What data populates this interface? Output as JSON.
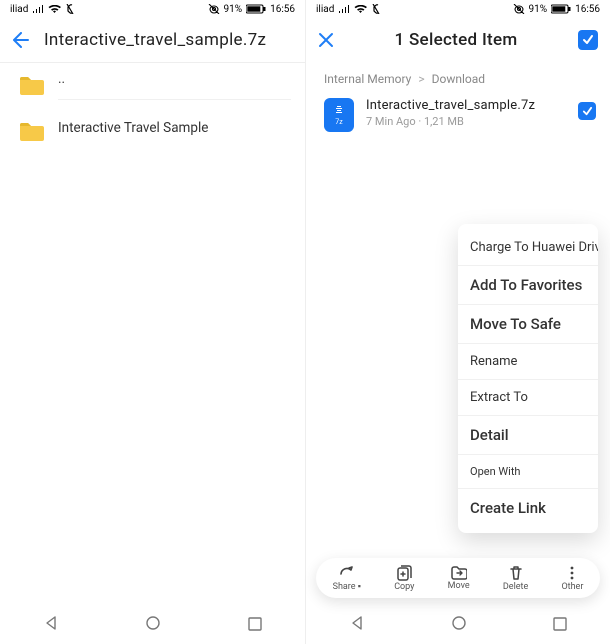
{
  "status": {
    "carrier": "iliad",
    "battery": "91%",
    "time": "16:56"
  },
  "left_pane": {
    "title": "Interactive_travel_sample.7z",
    "rows": [
      {
        "name": "..",
        "type": "updir"
      },
      {
        "name": "Interactive Travel Sample",
        "type": "folder"
      }
    ]
  },
  "right_pane": {
    "title": "1 Selected Item",
    "breadcrumb": {
      "root": "Internal Memory",
      "child": "Download"
    },
    "file": {
      "icon_label": "7z",
      "name": "Interactive_travel_sample.7z",
      "subtitle": "7 Min Ago · 1,21 MB",
      "checked": true
    },
    "context_menu": [
      "Charge To Huawei Drive",
      "Add To Favorites",
      "Move To Safe",
      "Rename",
      "Extract To",
      "Detail",
      "Open With",
      "Create Link"
    ],
    "actions": [
      {
        "id": "share",
        "label": "Share ▪"
      },
      {
        "id": "copy",
        "label": "Copy"
      },
      {
        "id": "move",
        "label": "Move"
      },
      {
        "id": "delete",
        "label": "Delete"
      },
      {
        "id": "other",
        "label": "Other"
      }
    ]
  }
}
